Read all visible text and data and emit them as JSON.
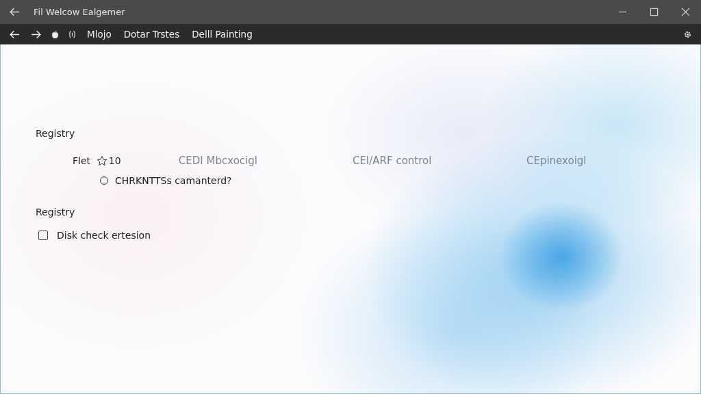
{
  "window": {
    "title": "Fil Welcow Ealgemer"
  },
  "toolbar": {
    "items": [
      "Mlojo",
      "Dotar Trstes",
      "Delll Painting"
    ]
  },
  "sections": [
    {
      "heading": "Registry",
      "row": {
        "label": "Flet",
        "count": "10",
        "columns": [
          "CEDI Mbcxocigl",
          "CEI/ARF control",
          "CEpinexoigl"
        ]
      },
      "radio": {
        "label": "CHRKNTTSs camanterd?",
        "selected": false
      }
    },
    {
      "heading": "Registry",
      "checkbox": {
        "label": "Disk check ertesion",
        "checked": false
      }
    }
  ]
}
